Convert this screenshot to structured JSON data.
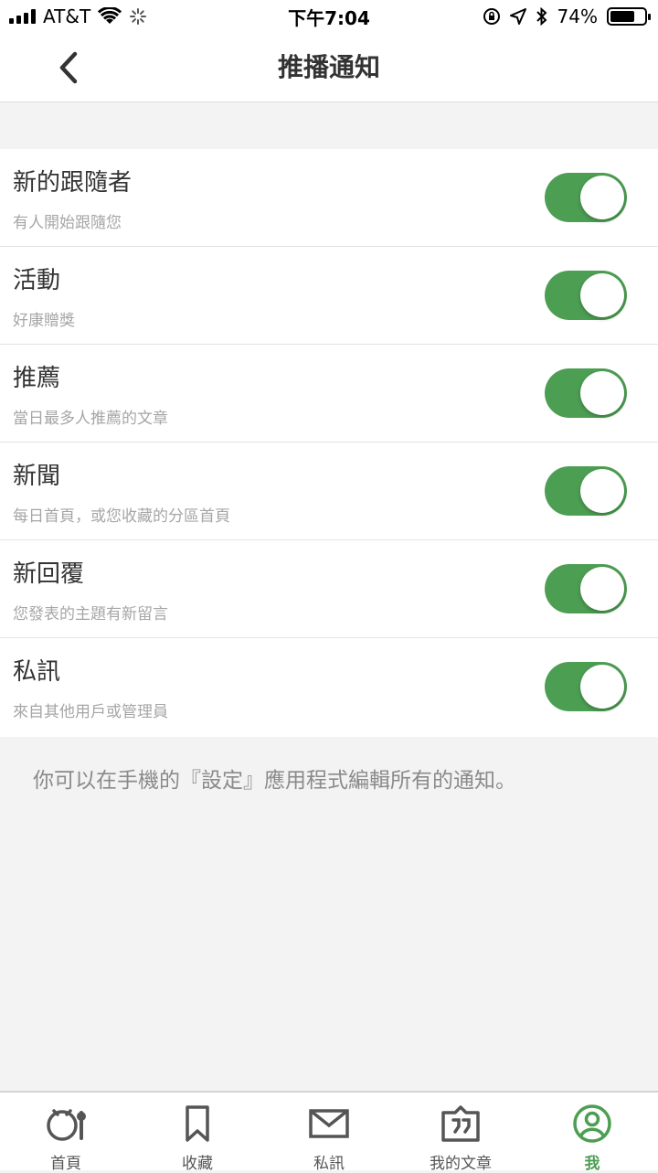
{
  "status_bar": {
    "carrier": "AT&T",
    "time": "下午7:04",
    "battery": "74%",
    "battery_level": 0.74
  },
  "nav": {
    "title": "推播通知",
    "back_icon": "chevron-left-icon"
  },
  "settings": [
    {
      "title": "新的跟隨者",
      "desc": "有人開始跟隨您",
      "enabled": true
    },
    {
      "title": "活動",
      "desc": "好康贈獎",
      "enabled": true
    },
    {
      "title": "推薦",
      "desc": "當日最多人推薦的文章",
      "enabled": true
    },
    {
      "title": "新聞",
      "desc": "每日首頁，或您收藏的分區首頁",
      "enabled": true
    },
    {
      "title": "新回覆",
      "desc": "您發表的主題有新留言",
      "enabled": true
    },
    {
      "title": "私訊",
      "desc": "來自其他用戶或管理員",
      "enabled": true
    }
  ],
  "footer_note": "你可以在手機的『設定』應用程式編輯所有的通知。",
  "tabs": [
    {
      "label": "首頁",
      "icon": "home-icon",
      "active": false
    },
    {
      "label": "收藏",
      "icon": "bookmark-icon",
      "active": false
    },
    {
      "label": "私訊",
      "icon": "mail-icon",
      "active": false
    },
    {
      "label": "我的文章",
      "icon": "quote-icon",
      "active": false
    },
    {
      "label": "我",
      "icon": "user-icon",
      "active": true
    }
  ],
  "colors": {
    "accent": "#4c9e52",
    "background": "#f3f3f3"
  }
}
